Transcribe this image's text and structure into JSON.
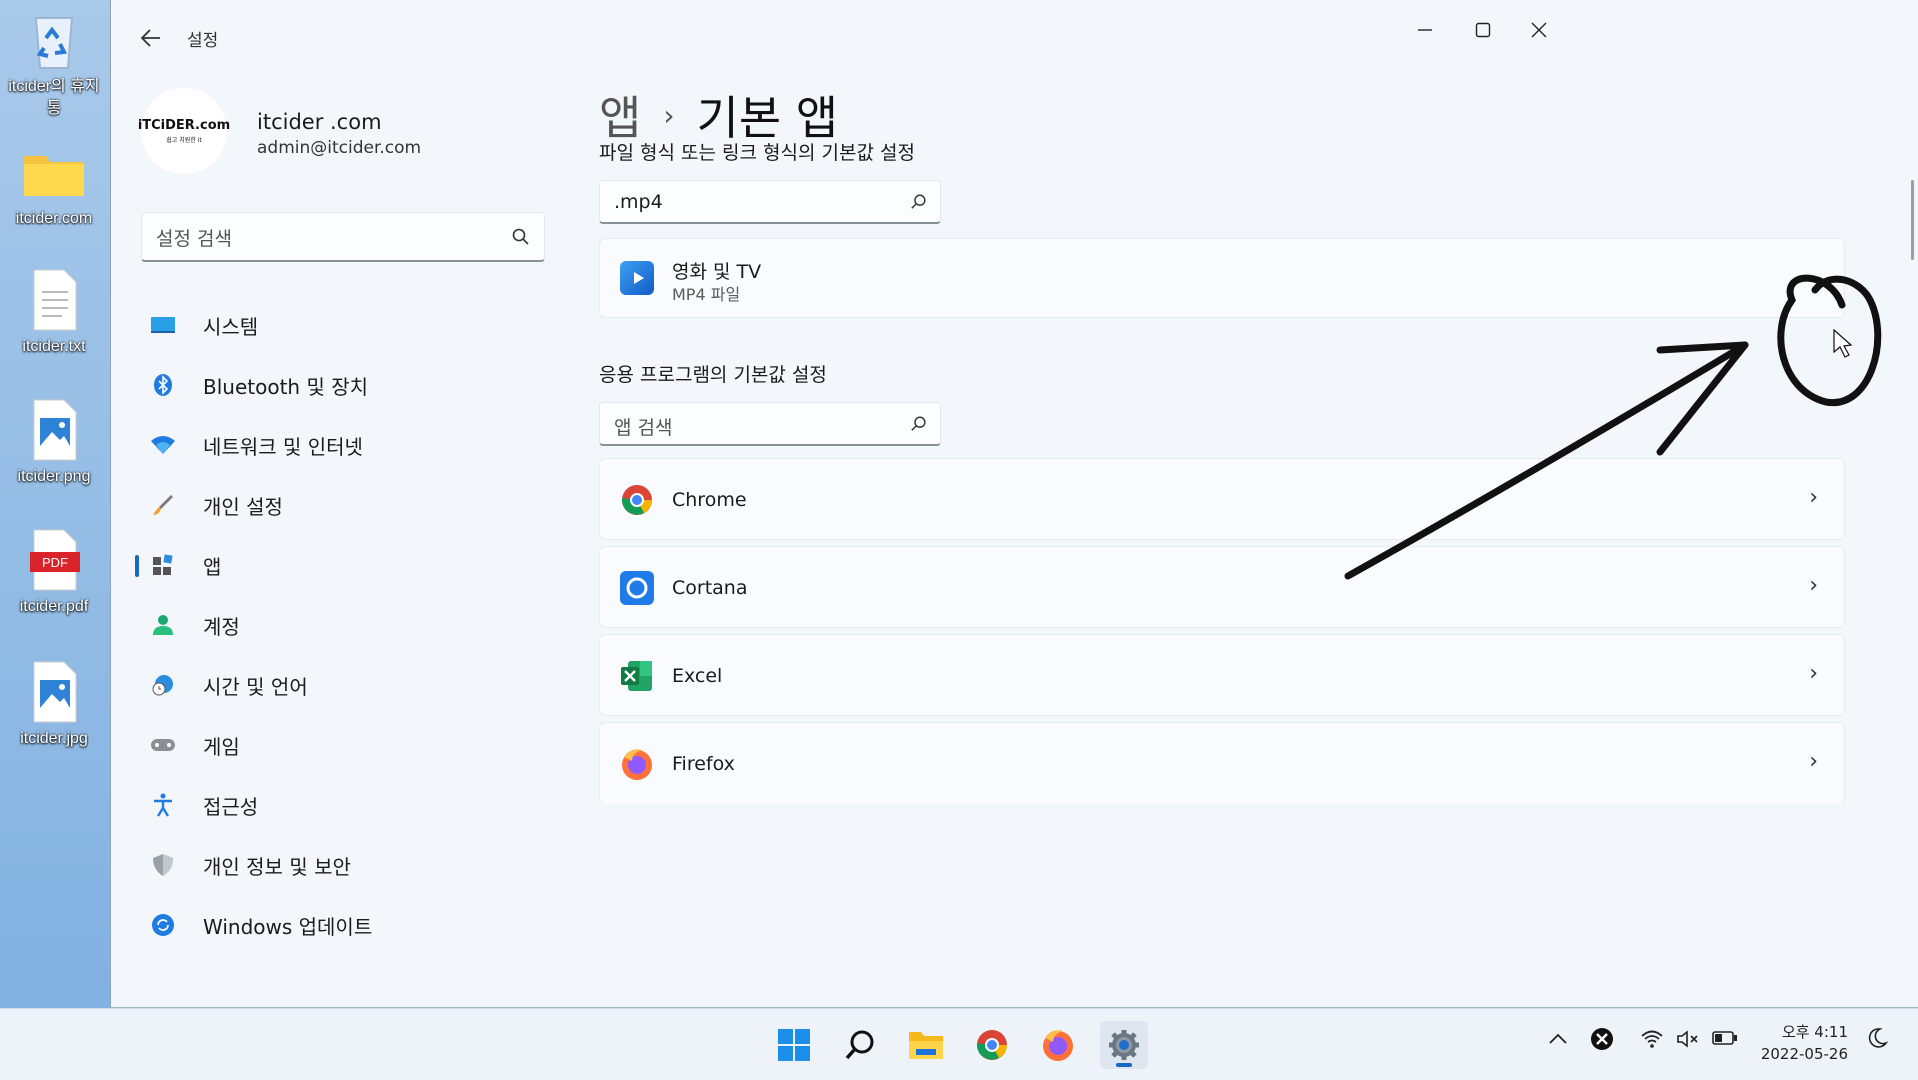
{
  "desktop": {
    "icons": [
      {
        "label": "itcider의 휴지통",
        "icon": "recycle-bin-icon"
      },
      {
        "label": "itcider.com",
        "icon": "folder-icon"
      },
      {
        "label": "itcider.txt",
        "icon": "text-file-icon"
      },
      {
        "label": "itcider.png",
        "icon": "image-file-icon"
      },
      {
        "label": "itcider.pdf",
        "icon": "pdf-file-icon"
      },
      {
        "label": "itcider.jpg",
        "icon": "image-file-icon"
      }
    ],
    "pdf_badge": "PDF"
  },
  "window": {
    "title": "설정",
    "back_icon": "arrow-left-icon",
    "controls": [
      "minimize",
      "maximize",
      "close"
    ]
  },
  "profile": {
    "avatar_text": "iTCiDER.com",
    "avatar_subtext": "쉽고 치원한 it",
    "name": "itcider .com",
    "email": "admin@itcider.com"
  },
  "sidebar": {
    "search_placeholder": "설정 검색",
    "items": [
      {
        "label": "시스템",
        "icon": "monitor-icon"
      },
      {
        "label": "Bluetooth 및 장치",
        "icon": "bluetooth-icon"
      },
      {
        "label": "네트워크 및 인터넷",
        "icon": "wifi-icon"
      },
      {
        "label": "개인 설정",
        "icon": "brush-icon"
      },
      {
        "label": "앱",
        "icon": "apps-icon",
        "active": true
      },
      {
        "label": "계정",
        "icon": "person-icon"
      },
      {
        "label": "시간 및 언어",
        "icon": "globe-clock-icon"
      },
      {
        "label": "게임",
        "icon": "gamepad-icon"
      },
      {
        "label": "접근성",
        "icon": "accessibility-icon"
      },
      {
        "label": "개인 정보 및 보안",
        "icon": "shield-icon"
      },
      {
        "label": "Windows 업데이트",
        "icon": "update-icon"
      }
    ]
  },
  "main": {
    "breadcrumb_parent": "앱",
    "breadcrumb_current": "기본 앱",
    "filetype_section_title": "파일 형식 또는 링크 형식의 기본값 설정",
    "filetype_search_value": ".mp4",
    "filetype_result": {
      "name": "영화 및 TV",
      "sub": "MP4 파일",
      "icon": "movies-tv-icon"
    },
    "apps_section_title": "응용 프로그램의 기본값 설정",
    "apps_search_placeholder": "앱 검색",
    "apps": [
      {
        "name": "Chrome",
        "icon": "chrome-icon"
      },
      {
        "name": "Cortana",
        "icon": "cortana-icon"
      },
      {
        "name": "Excel",
        "icon": "excel-icon"
      },
      {
        "name": "Firefox",
        "icon": "firefox-icon"
      }
    ]
  },
  "taskbar": {
    "apps": [
      "start-icon",
      "search-icon",
      "file-explorer-icon",
      "chrome-icon",
      "firefox-icon",
      "settings-icon"
    ],
    "clock_time": "오후 4:11",
    "clock_date": "2022-05-26"
  }
}
